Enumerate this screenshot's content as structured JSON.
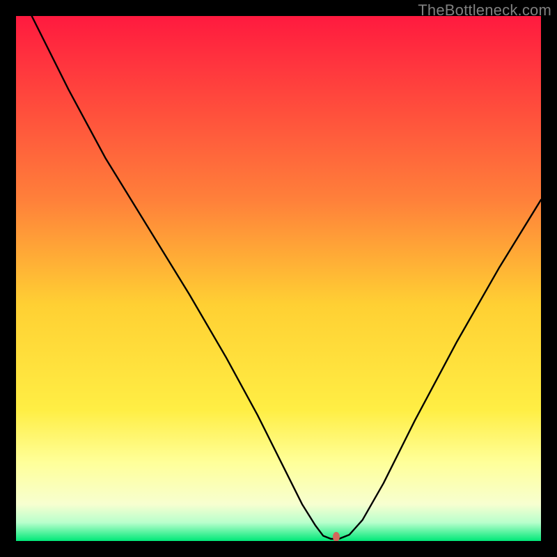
{
  "watermark": "TheBottleneck.com",
  "chart_data": {
    "type": "line",
    "title": "",
    "xlabel": "",
    "ylabel": "",
    "xlim": [
      0,
      100
    ],
    "ylim": [
      0,
      100
    ],
    "grid": false,
    "legend": false,
    "gradient": {
      "stops": [
        {
          "offset": 0.0,
          "color": "#ff1a3f"
        },
        {
          "offset": 0.35,
          "color": "#ff803a"
        },
        {
          "offset": 0.55,
          "color": "#ffd033"
        },
        {
          "offset": 0.75,
          "color": "#ffee44"
        },
        {
          "offset": 0.85,
          "color": "#ffff99"
        },
        {
          "offset": 0.93,
          "color": "#f7ffd0"
        },
        {
          "offset": 0.965,
          "color": "#b8ffcc"
        },
        {
          "offset": 1.0,
          "color": "#00e878"
        }
      ]
    },
    "series": [
      {
        "name": "bottleneck-curve",
        "color": "#000000",
        "x": [
          3,
          10,
          17,
          25,
          33,
          40,
          46,
          51,
          54.5,
          57,
          58.5,
          60,
          61.5,
          63.5,
          66,
          70,
          76,
          84,
          92,
          100
        ],
        "y": [
          100,
          86,
          73,
          60,
          47,
          35,
          24,
          14,
          7,
          3,
          1,
          0.4,
          0.4,
          1.2,
          4,
          11,
          23,
          38,
          52,
          65
        ]
      }
    ],
    "marker": {
      "name": "optimal-point",
      "x": 61,
      "y": 0.8,
      "rx": 5,
      "ry": 7,
      "color": "#d1695b"
    }
  }
}
